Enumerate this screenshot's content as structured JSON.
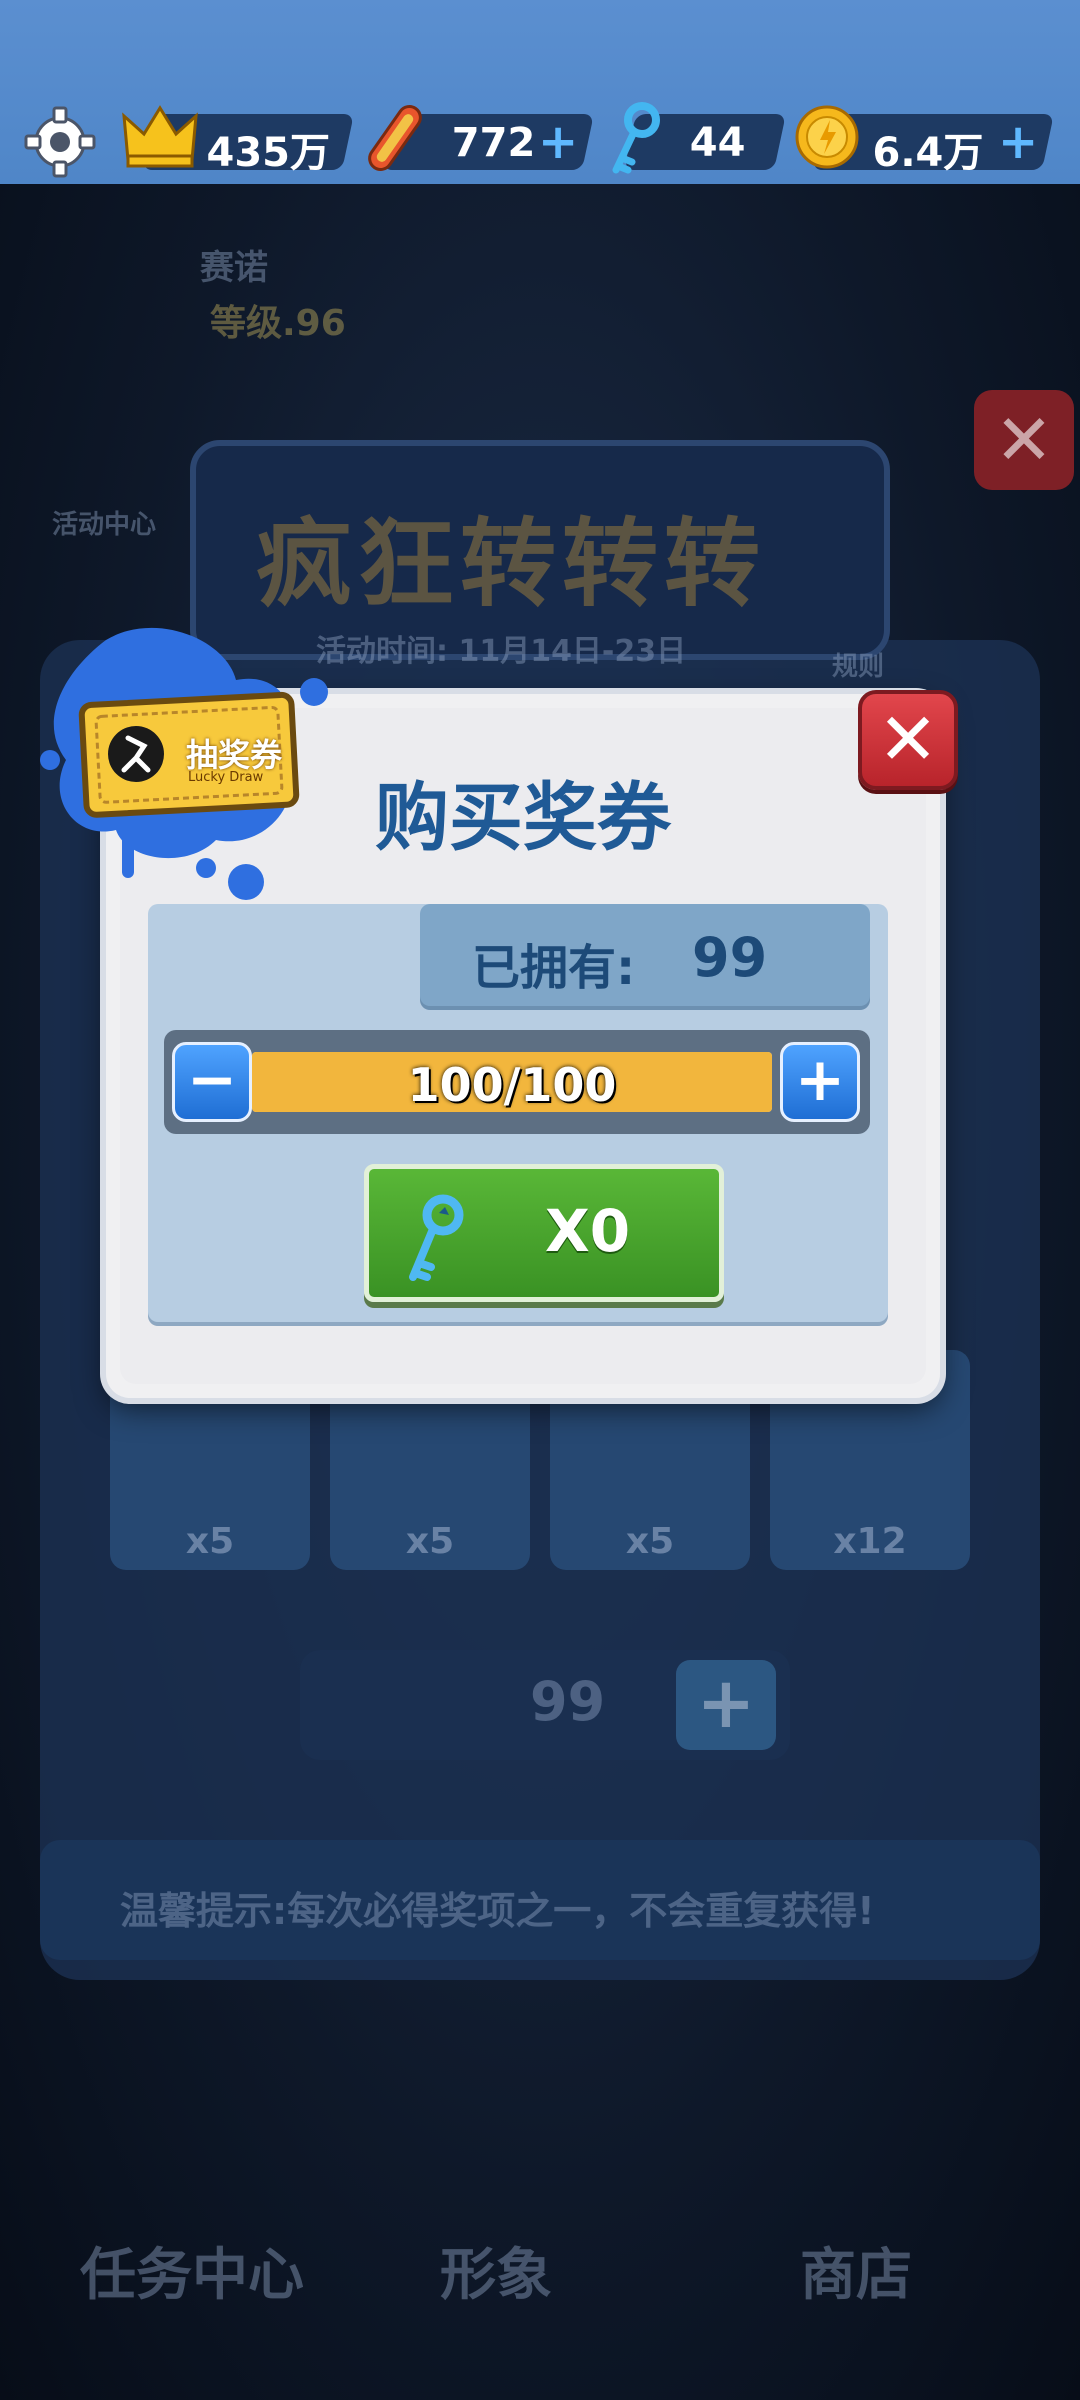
{
  "topbar": {
    "crown_value": "435万",
    "board_value": "772",
    "key_value": "44",
    "coin_value": "6.4万"
  },
  "background": {
    "player_name": "赛诺",
    "player_level": "等级.96",
    "event_center": "活动中心",
    "event_title": "疯狂转转转",
    "event_time": "活动时间: 11月14日-23日",
    "rules_label": "规则",
    "slots": [
      {
        "count": "x5"
      },
      {
        "count": "x5"
      },
      {
        "count": "x5"
      },
      {
        "count": "x12"
      }
    ],
    "ticket_count": "99",
    "tip": "温馨提示:每次必得奖项之一，不会重复获得!",
    "nav": [
      "任务中心",
      "形象",
      "商店"
    ]
  },
  "dialog": {
    "ticket_badge": "抽奖券",
    "ticket_badge_sub": "Lucky Draw",
    "title": "购买奖券",
    "owned_label": "已拥有:",
    "owned_value": "99",
    "quantity": "100/100",
    "quantity_fraction": 1.0,
    "price": "X0"
  },
  "colors": {
    "accent": "#1f5a96",
    "buy_green": "#4aa52e",
    "close_red": "#c8323a",
    "bar_yellow": "#f2b63d"
  }
}
